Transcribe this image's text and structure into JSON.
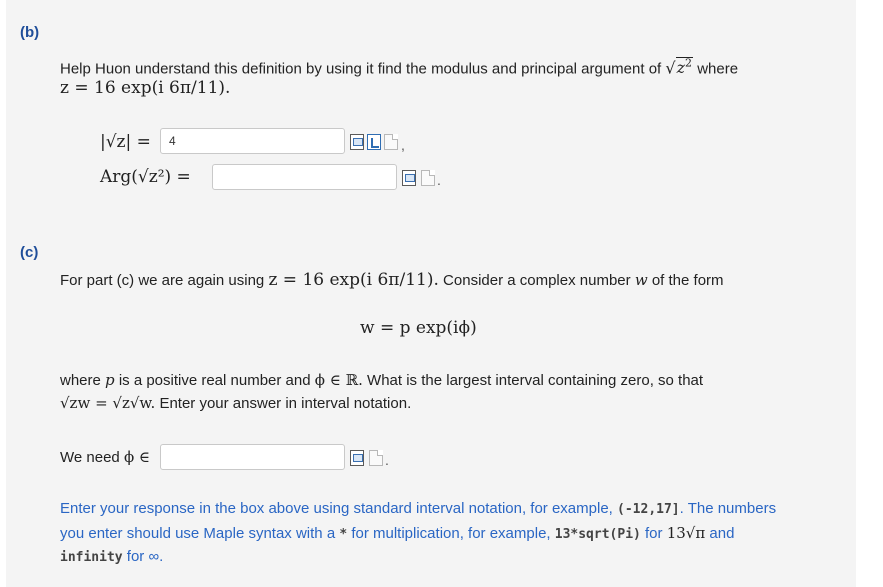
{
  "part_b": {
    "label": "(b)",
    "prompt": "Help Huon understand this definition by using it find the modulus and principal argument of",
    "where": "where",
    "z_def": "z = 16 exp(i 6π/11).",
    "modulus_label_lhs": "|√z| =",
    "modulus_value": "4",
    "arg_label": "Arg(√z²) =",
    "arg_value": "",
    "comma": ",",
    "period": "."
  },
  "part_c": {
    "label": "(c)",
    "intro_start": "For part (c) we are again using",
    "z_def": "z = 16 exp(i 6π/11).",
    "intro_end": "Consider a complex number",
    "w_var": "w",
    "intro_tail": "of the form",
    "w_formula": "w = p exp(iϕ)",
    "where_text_1": "where",
    "p_var": "p",
    "where_text_2": "is a positive real number and",
    "phi_in_R": "ϕ ∈ ℝ.",
    "where_text_3": "What is the largest interval containing zero, so that",
    "identity": "√zw = √z√w.",
    "enter_text": "Enter your answer in interval notation.",
    "we_need": "We need",
    "phi_in": "ϕ ∈",
    "interval_value": "",
    "period": "."
  },
  "hint": {
    "line1_a": "Enter your response in the box above using standard interval notation, for example,",
    "line1_code": "(-12,17]",
    "line1_b": ". The numbers",
    "line2_a": "you enter should use Maple syntax with a",
    "line2_code1": "*",
    "line2_b": "for multiplication, for example,",
    "line2_code2": "13*sqrt(Pi)",
    "line2_c": "for",
    "line2_math": "13√π",
    "line2_d": "and",
    "line3_code": "infinity",
    "line3_b": "for ∞."
  }
}
